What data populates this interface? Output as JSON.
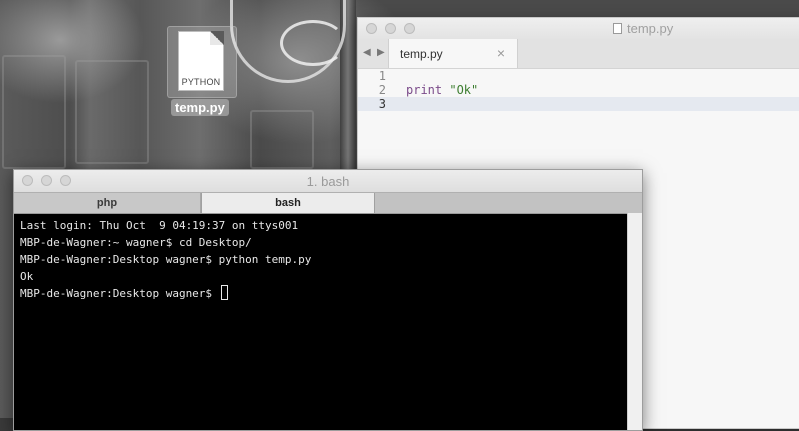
{
  "desktop": {
    "file_icon": {
      "type_label": "PYTHON",
      "name": "temp.py",
      "icon": "python-file-icon"
    }
  },
  "editor": {
    "window_title": "temp.py",
    "tab": {
      "label": "temp.py",
      "close": "×"
    },
    "nav": {
      "back": "◀",
      "forward": "▶"
    },
    "lines": [
      {
        "number": "1",
        "code": ""
      },
      {
        "number": "2",
        "code_kw": "print",
        "code_str": "\"Ok\""
      },
      {
        "number": "3",
        "code": ""
      }
    ],
    "current_line": "3"
  },
  "terminal": {
    "window_title": "1. bash",
    "tabs": [
      {
        "label": "php",
        "active": false
      },
      {
        "label": "bash",
        "active": true
      }
    ],
    "lines": [
      "Last login: Thu Oct  9 04:19:37 on ttys001",
      "MBP-de-Wagner:~ wagner$ cd Desktop/",
      "MBP-de-Wagner:Desktop wagner$ python temp.py",
      "Ok",
      "MBP-de-Wagner:Desktop wagner$ "
    ]
  }
}
